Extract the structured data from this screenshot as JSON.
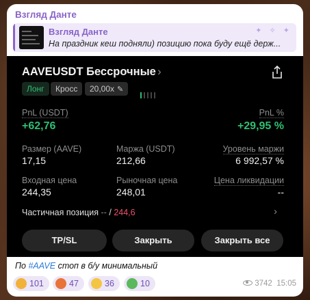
{
  "channel": {
    "name": "Взгляд Данте"
  },
  "reply": {
    "title": "Взгляд Данте",
    "text": "На праздник кеш подняли) позицию пока буду ещё держ..."
  },
  "position": {
    "title": "AAVEUSDT Бессрочные",
    "side": "Лонг",
    "margin_mode": "Кросс",
    "leverage": "20,00x",
    "pnl_label": "PnL (USDT)",
    "pnl_value": "+62,76",
    "pnl_pct_label": "PnL %",
    "pnl_pct_value": "+29,95 %",
    "size_label": "Размер (AAVE)",
    "size_value": "17,15",
    "margin_label": "Маржа (USDT)",
    "margin_value": "212,66",
    "margin_level_label": "Уровень маржи",
    "margin_level_value": "6 992,57 %",
    "entry_label": "Входная цена",
    "entry_value": "244,35",
    "mark_label": "Рыночная цена",
    "mark_value": "248,01",
    "liq_label": "Цена ликвидации",
    "liq_value": "--",
    "partial_label": "Частичная позиция",
    "partial_dash": "--",
    "partial_sep": "/",
    "partial_value": "244,6",
    "btn_tpsl": "TP/SL",
    "btn_close": "Закрыть",
    "btn_close_all": "Закрыть все",
    "signal_bars_active": 1,
    "signal_bars_total": 5
  },
  "caption": {
    "prefix": "По ",
    "hashtag": "#AAVE",
    "suffix": " стоп в б/у минимальный"
  },
  "reactions": [
    {
      "icon": "lion-emoji-icon",
      "count": "101",
      "color": "#f0b23a"
    },
    {
      "icon": "angry-cat-emoji-icon",
      "count": "47",
      "color": "#e8743a"
    },
    {
      "icon": "pill-emoji-icon",
      "count": "36",
      "color": "#f4c542"
    },
    {
      "icon": "money-plant-emoji-icon",
      "count": "10",
      "color": "#5cb85c"
    }
  ],
  "meta": {
    "views": "3742",
    "time": "15:05"
  },
  "colors": {
    "accent": "#8a63c8",
    "profit": "#2fbf71",
    "loss": "#f0516b",
    "link": "#2a7bd6"
  }
}
